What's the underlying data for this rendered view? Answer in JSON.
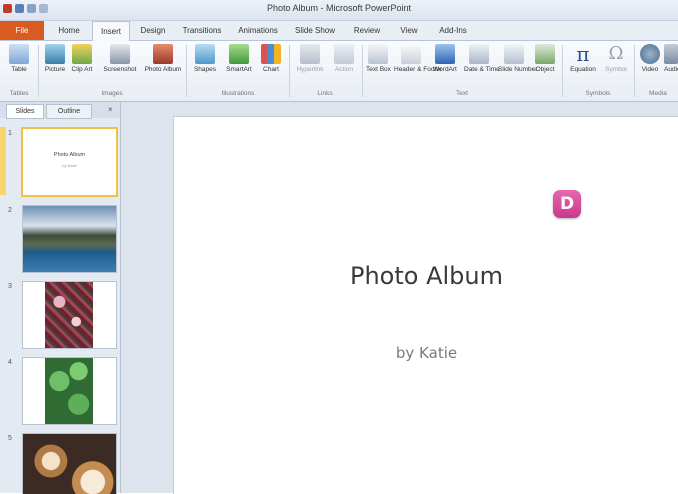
{
  "window": {
    "title": "Photo Album - Microsoft PowerPoint"
  },
  "ribbon_tabs": [
    "File",
    "Home",
    "Insert",
    "Design",
    "Transitions",
    "Animations",
    "Slide Show",
    "Review",
    "View",
    "Add-Ins"
  ],
  "active_tab": "Insert",
  "ribbon_groups": [
    {
      "name": "Tables",
      "buttons": [
        "Table"
      ]
    },
    {
      "name": "Images",
      "buttons": [
        "Picture",
        "Clip Art",
        "Screenshot",
        "Photo Album"
      ]
    },
    {
      "name": "Illustrations",
      "buttons": [
        "Shapes",
        "SmartArt",
        "Chart"
      ]
    },
    {
      "name": "Links",
      "buttons": [
        "Hyperlink",
        "Action"
      ]
    },
    {
      "name": "Text",
      "buttons": [
        "Text Box",
        "Header & Footer",
        "WordArt",
        "Date & Time",
        "Slide Number",
        "Object"
      ]
    },
    {
      "name": "Symbols",
      "buttons": [
        "Equation",
        "Symbol"
      ]
    },
    {
      "name": "Media",
      "buttons": [
        "Video",
        "Audio"
      ]
    }
  ],
  "pane": {
    "tabs": [
      "Slides",
      "Outline"
    ],
    "close": "×"
  },
  "thumbnails": [
    {
      "num": "1",
      "title": "Photo Album",
      "subtitle": "by Katie"
    },
    {
      "num": "2"
    },
    {
      "num": "3"
    },
    {
      "num": "4"
    },
    {
      "num": "5"
    }
  ],
  "slide": {
    "title": "Photo Album",
    "subtitle": "by Katie"
  },
  "callout": {
    "label": "D"
  },
  "colors": {
    "file_tab": "#d95b22",
    "callout": "#d84b9e",
    "selection": "#f6d66b"
  }
}
